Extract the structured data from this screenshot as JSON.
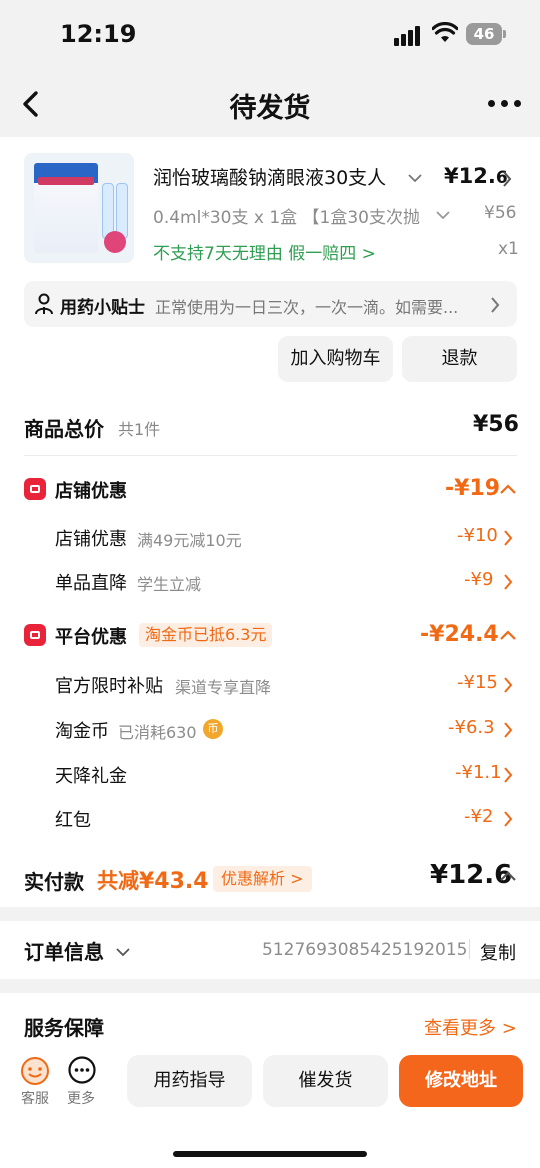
{
  "status_bar": {
    "time": "12:19",
    "battery": "46"
  },
  "nav": {
    "title": "待发货",
    "back_icon": "chevron-left-icon",
    "more_icon": "more-horizontal-icon"
  },
  "product": {
    "name": "润怡玻璃酸钠滴眼液30支人",
    "price_main": "¥12.",
    "price_decimal": "6",
    "spec": "0.4ml*30支 x 1盒 【1盒30支次抛",
    "original_price": "¥56",
    "tags": "不支持7天无理由  假一赔四 >",
    "quantity": "x1",
    "thumb_alt": "玻璃酸钠滴眼液"
  },
  "tip": {
    "title": "用药小贴士",
    "text": "正常使用为一日三次，一次一滴。如需要..."
  },
  "actions": {
    "add_cart": "加入购物车",
    "refund": "退款"
  },
  "total": {
    "label": "商品总价",
    "count": "共1件",
    "amount": "¥56"
  },
  "shop_discount": {
    "title": "店铺优惠",
    "amount": "-¥19",
    "lines": [
      {
        "label": "店铺优惠",
        "note": "满49元减10元",
        "amount": "-¥10"
      },
      {
        "label": "单品直降",
        "note": "学生立减",
        "amount": "-¥9"
      }
    ]
  },
  "platform_discount": {
    "title": "平台优惠",
    "tag": "淘金币已抵6.3元",
    "amount": "-¥24.4",
    "lines": [
      {
        "label": "官方限时补贴",
        "note": "渠道专享直降",
        "amount": "-¥15"
      },
      {
        "label": "淘金币",
        "note": "已消耗630",
        "amount": "-¥6.3",
        "coin": "币"
      },
      {
        "label": "天降礼金",
        "note": "",
        "amount": "-¥1.1"
      },
      {
        "label": "红包",
        "note": "",
        "amount": "-¥2"
      }
    ]
  },
  "payment": {
    "label": "实付款",
    "save_prefix": "共减",
    "save_amount": "¥43.4",
    "badge": "优惠解析 >",
    "total": "¥12.6"
  },
  "order": {
    "label": "订单信息",
    "number": "5127693085425192015",
    "copy": "复制"
  },
  "service": {
    "label": "服务保障",
    "more": "查看更多 >"
  },
  "bottom_bar": {
    "service_label": "客服",
    "more_label": "更多",
    "guide": "用药指导",
    "urge": "催发货",
    "modify": "修改地址"
  },
  "colors": {
    "accent": "#f06a16",
    "red": "#e8233a",
    "green": "#2f9e52",
    "primary_button": "#f5661d"
  }
}
